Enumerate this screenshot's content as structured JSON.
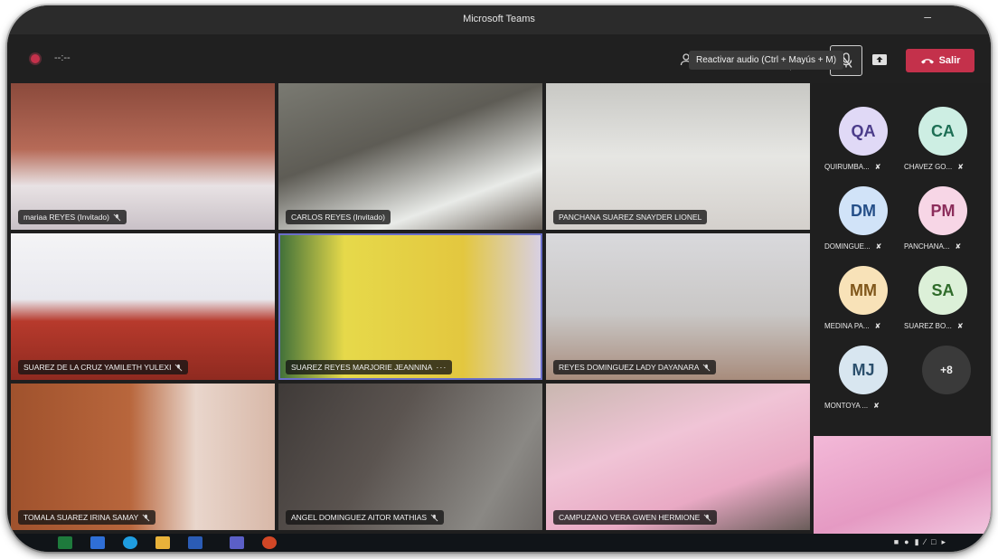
{
  "window": {
    "title": "Microsoft Teams",
    "minimize_glyph": "–"
  },
  "toolbar": {
    "timer": "--:--",
    "icons": [
      "participants-icon",
      "reactions-icon",
      "more-icon",
      "camera-icon",
      "mic-off-icon",
      "share-icon"
    ],
    "leave_label": "Salir",
    "tooltip": "Reactivar audio (Ctrl + Mayús + M)"
  },
  "colors": {
    "accent": "#6a6fc9",
    "leave": "#c4314b",
    "background": "#1f1f1f"
  },
  "tiles": [
    {
      "name": "mariaa REYES (Invitado)"
    },
    {
      "name": "CARLOS REYES (Invitado)"
    },
    {
      "name": "PANCHANA SUAREZ SNAYDER LIONEL"
    },
    {
      "name": "SUAREZ DE LA CRUZ YAMILETH YULEXI"
    },
    {
      "name": "SUAREZ REYES MARJORIE JEANNINA",
      "more": "···"
    },
    {
      "name": "REYES DOMINGUEZ LADY DAYANARA"
    },
    {
      "name": "TOMALA SUAREZ IRINA SAMAY"
    },
    {
      "name": "ANGEL DOMINGUEZ AITOR MATHIAS"
    },
    {
      "name": "CAMPUZANO VERA GWEN HERMIONE"
    }
  ],
  "avatars": [
    {
      "initials": "QA",
      "name": "QUIRUMBA...",
      "bg": "#e0d9f6",
      "fg": "#4b3c8a"
    },
    {
      "initials": "CA",
      "name": "CHAVEZ GO...",
      "bg": "#cdeee3",
      "fg": "#1e6f55"
    },
    {
      "initials": "DM",
      "name": "DOMINGUE...",
      "bg": "#d1e3f8",
      "fg": "#254f88"
    },
    {
      "initials": "PM",
      "name": "PANCHANA...",
      "bg": "#f7d6e6",
      "fg": "#8c2d5b"
    },
    {
      "initials": "MM",
      "name": "MEDINA PA...",
      "bg": "#f8e2b8",
      "fg": "#80571b"
    },
    {
      "initials": "SA",
      "name": "SUAREZ BO...",
      "bg": "#dcf0d8",
      "fg": "#2f6b2a"
    },
    {
      "initials": "MJ",
      "name": "MONTOYA ...",
      "bg": "#d8e6f0",
      "fg": "#2b4f6c"
    }
  ],
  "overflow": {
    "label": "+8"
  }
}
